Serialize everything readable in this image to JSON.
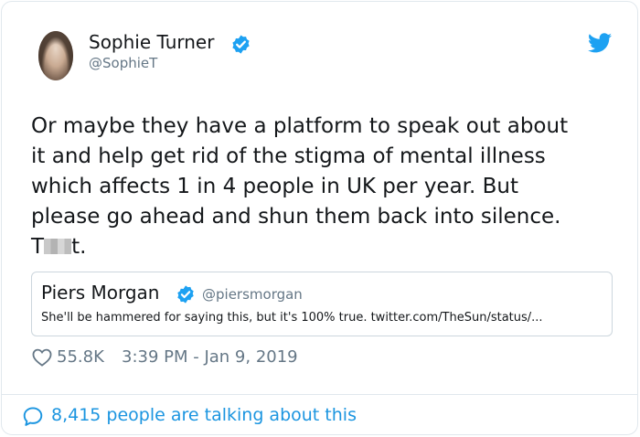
{
  "author": {
    "name": "Sophie Turner",
    "handle": "@SophieT"
  },
  "tweet": {
    "lines": [
      "Or maybe they have a platform to speak out about",
      "it and help get rid of the stigma of mental illness",
      "which affects 1 in 4 people in UK per year. But",
      "please go ahead and shun them back into silence."
    ],
    "last_line_start": "T",
    "last_line_end": "t."
  },
  "quote": {
    "name": "Piers Morgan",
    "handle": "@piersmorgan",
    "text": "She'll be hammered for saying this, but it's 100% true. twitter.com/TheSun/status/..."
  },
  "stats": {
    "likes": "55.8K",
    "timestamp": "3:39 PM - Jan 9, 2019"
  },
  "footer": {
    "talking": "8,415 people are talking about this"
  },
  "colors": {
    "verified": "#1da1f2",
    "link": "#1b95e0",
    "muted": "#657786"
  },
  "icons": [
    "verified-badge-icon",
    "twitter-bird-icon",
    "heart-icon",
    "comment-icon"
  ]
}
